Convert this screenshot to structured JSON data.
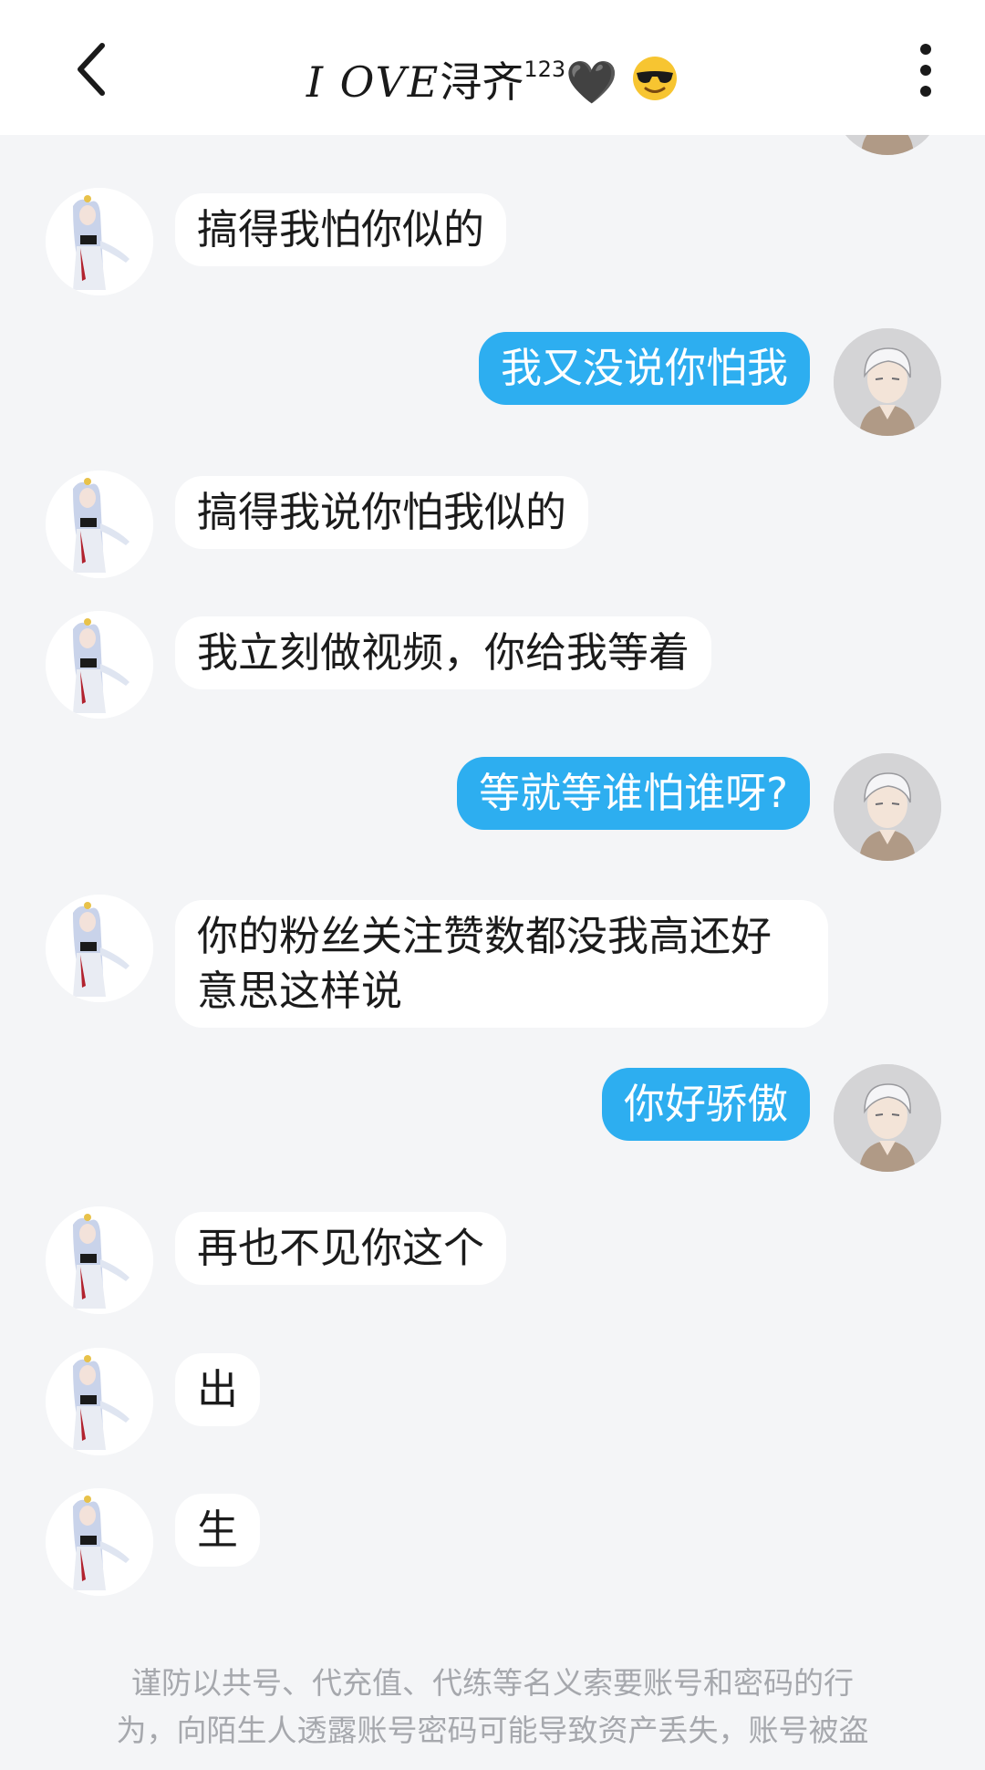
{
  "header": {
    "title_script": "I OVE",
    "title_text": "浔齐",
    "title_sup": "123",
    "title_heart": "🖤",
    "title_emoji": "sunglasses-emoji",
    "back_icon": "chevron-left-icon",
    "more_icon": "more-vertical-icon"
  },
  "messages": [
    {
      "side": "left",
      "text": "搞得我怕你似的"
    },
    {
      "side": "right",
      "text": "我又没说你怕我"
    },
    {
      "side": "left",
      "text": "搞得我说你怕我似的"
    },
    {
      "side": "left",
      "text": "我立刻做视频，你给我等着"
    },
    {
      "side": "right",
      "text": "等就等谁怕谁呀?"
    },
    {
      "side": "left",
      "text": "你的粉丝关注赞数都没我高还好意思这样说"
    },
    {
      "side": "right",
      "text": "你好骄傲"
    },
    {
      "side": "left",
      "text": "再也不见你这个"
    },
    {
      "side": "left",
      "text": "出"
    },
    {
      "side": "left",
      "text": "生"
    }
  ],
  "notice": {
    "line1": "谨防以共号、代充值、代练等名义索要账号和密码的行",
    "line2": "为，向陌生人透露账号密码可能导致资产丢失，账号被盗"
  },
  "colors": {
    "background": "#f4f5f7",
    "my_bubble": "#2daef0",
    "their_bubble": "#ffffff",
    "notice_text": "#a6a8ad"
  }
}
